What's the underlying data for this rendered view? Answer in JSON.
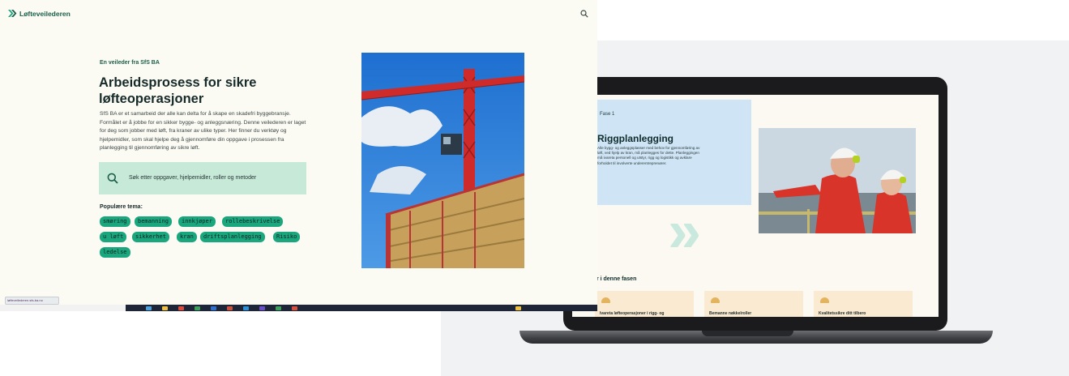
{
  "site": {
    "name": "Løfteveilederen",
    "kicker": "En veileder fra SfS BA",
    "title": "Arbeidsprosess for sikre løfteoperasjoner",
    "intro": "SfS BA er et samarbeid der alle kan delta for å skape en skadefri byggebransje. Formålet er å jobbe for en sikker bygge- og anleggsnæring. Denne veilederen er laget for deg som jobber med løft, fra kraner av ulike typer. Her finner du verktøy og hjelpemidler, som skal hjelpe deg å gjennomføre din oppgave i prosessen fra planlegging til gjennomføring av sikre løft.",
    "search_placeholder": "Søk etter oppgaver, hjelpemidler, roller og metoder",
    "popular_title": "Populære tema:",
    "tags": [
      "smøring",
      "bemanning",
      "innkjøper",
      "rollebeskrivelse",
      "u løft",
      "sikkerhet",
      "kran",
      "driftsplanlegging",
      "Risiko",
      "ledelse"
    ]
  },
  "laptop": {
    "phase_label": "Fase 1",
    "phase_title": "Riggplanlegging",
    "phase_body": "Alle bygg- og anleggsplasser med behov for gjennomføring av løft, ved hjelp av kran, må planlegges for dette. Planleggingen må ivareta personell og utstyr, rigg og logistikk og avklare forholdet til involverte underentreprenører.",
    "tasks_heading": "Oppgaver i denne fasen",
    "tasks": [
      "Ivareta løfteoperasjoner i rigg- og",
      "Bemanne nøkkelroller",
      "Kvalitetssikre ditt tilbero"
    ]
  },
  "status_url": "løfteveilederen.sfs-ba.no",
  "icons": {
    "logo": "double-chevron-icon",
    "search": "search-icon",
    "phase": "double-chevron-icon",
    "task": "hard-hat-icon"
  },
  "colors": {
    "brand_green": "#1c5e4a",
    "chip_green": "#1aa77e",
    "search_bg": "#c7e9d8",
    "phase_card": "#cfe5f6",
    "task_card": "#fbead2"
  }
}
